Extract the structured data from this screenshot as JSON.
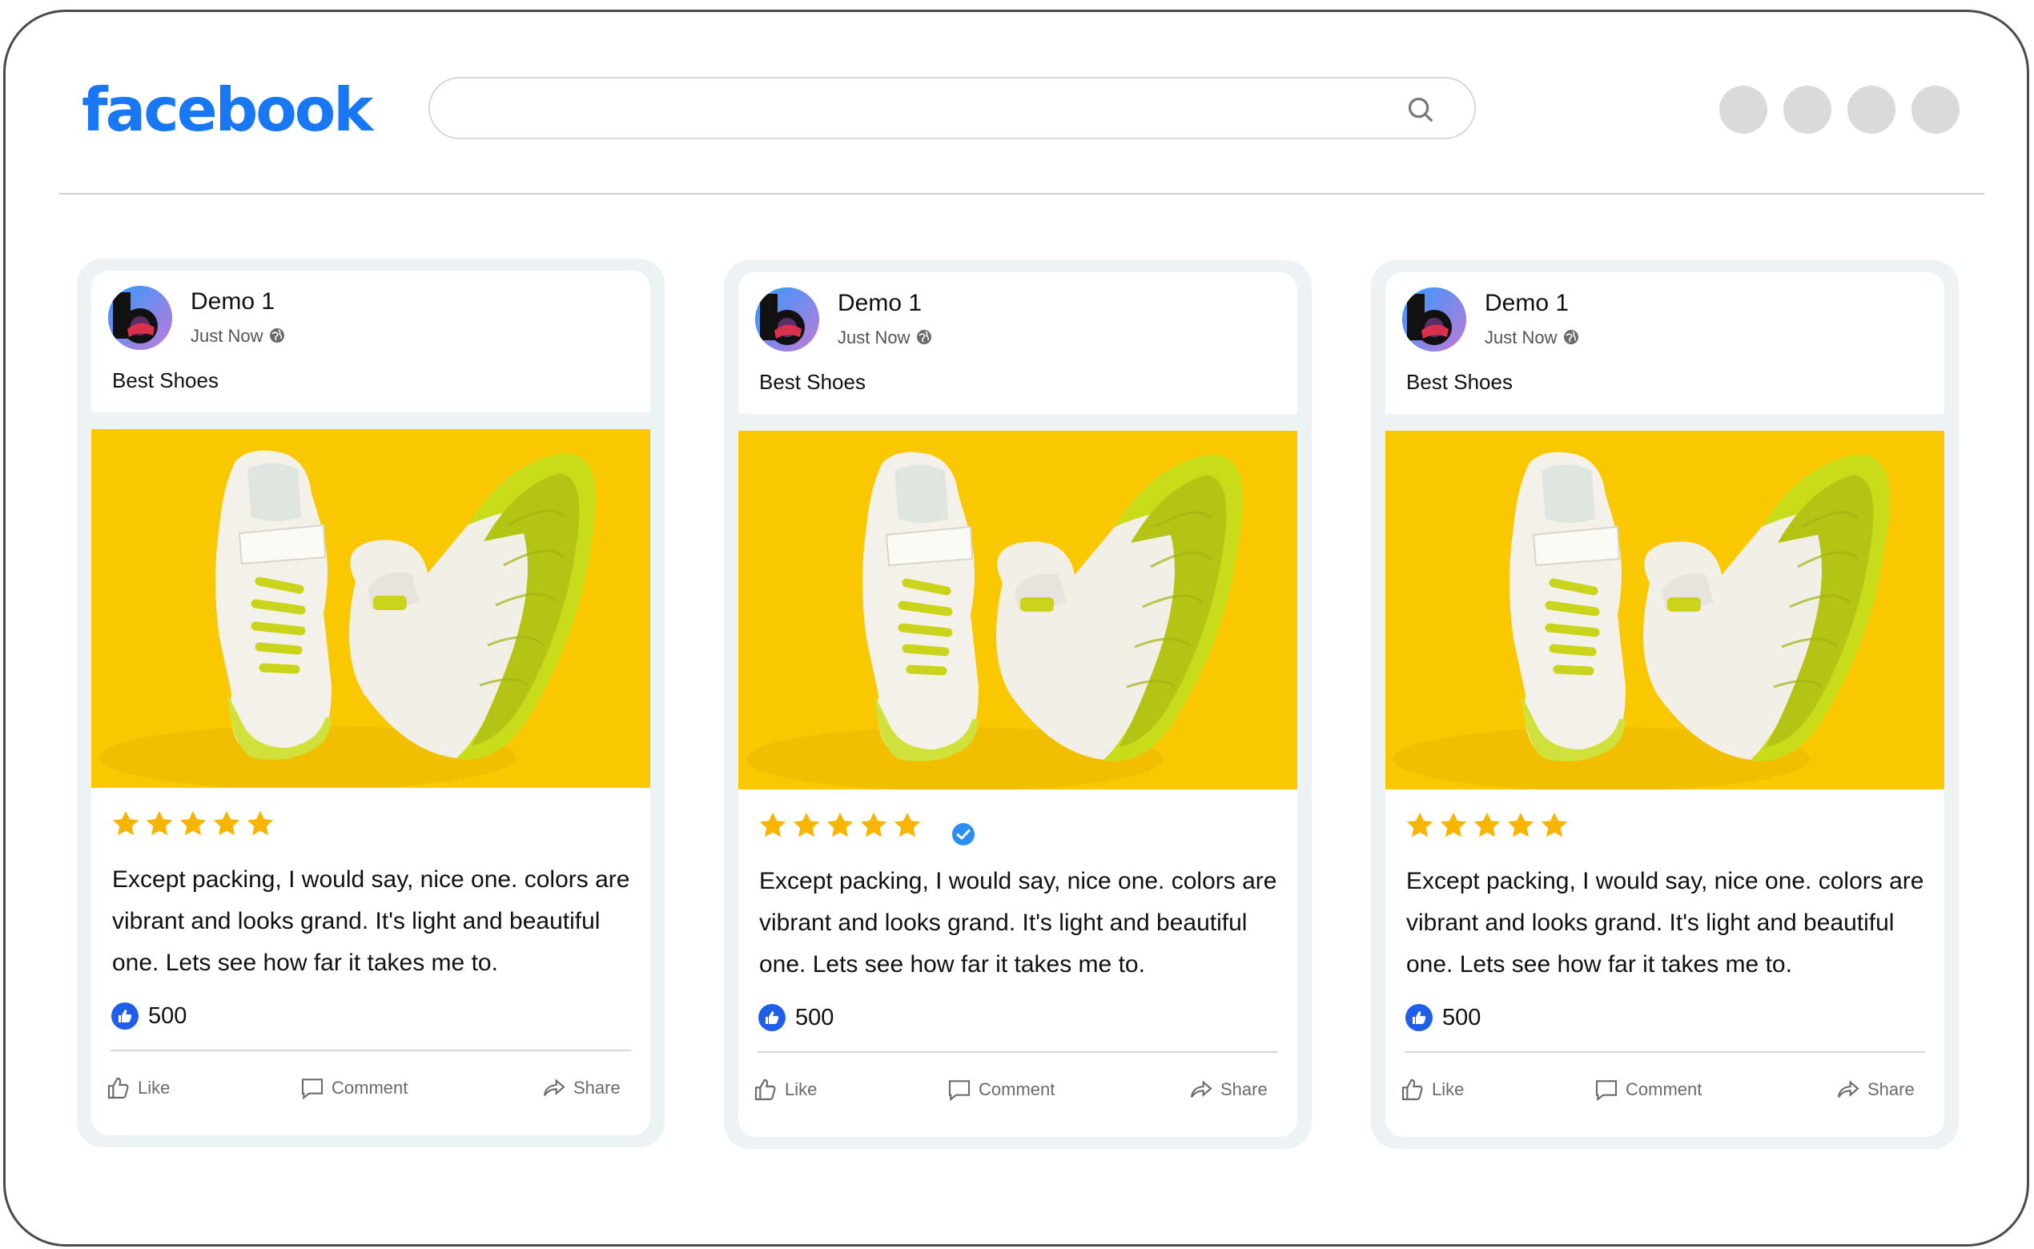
{
  "header": {
    "logo_text": "facebook",
    "brand_color": "#1877f2",
    "search": {
      "placeholder": "",
      "icon": "search-icon"
    },
    "nav_dots": 4
  },
  "cards": [
    {
      "author": "Demo 1",
      "time": "Just Now",
      "post_text": "Best Shoes",
      "rating": 5,
      "verified": false,
      "review": "Except packing, I would say, nice one. colors are vibrant and looks grand. It's light and beautiful one. Lets see how far it takes me to.",
      "likes": "500",
      "actions": {
        "like": "Like",
        "comment": "Comment",
        "share": "Share"
      }
    },
    {
      "author": "Demo 1",
      "time": "Just Now",
      "post_text": "Best Shoes",
      "rating": 5,
      "verified": true,
      "review": "Except packing, I would say, nice one. colors are vibrant and looks grand. It's light and beautiful one. Lets see how far it takes me to.",
      "likes": "500",
      "actions": {
        "like": "Like",
        "comment": "Comment",
        "share": "Share"
      }
    },
    {
      "author": "Demo 1",
      "time": "Just Now",
      "post_text": "Best Shoes",
      "rating": 5,
      "verified": false,
      "review": "Except packing, I would say, nice one. colors are vibrant and looks grand. It's light and beautiful one. Lets see how far it takes me to.",
      "likes": "500",
      "actions": {
        "like": "Like",
        "comment": "Comment",
        "share": "Share"
      }
    }
  ],
  "colors": {
    "star": "#f7b500",
    "photo_bg": "#f9c800",
    "like_badge": "#1f5ee8",
    "verified": "#2b8ff0"
  }
}
